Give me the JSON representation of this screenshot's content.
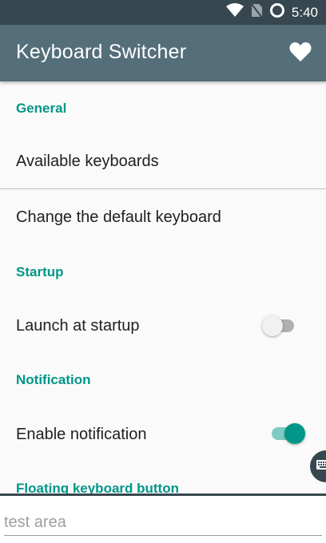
{
  "status_bar": {
    "time": "5:40"
  },
  "app_bar": {
    "title": "Keyboard Switcher"
  },
  "sections": {
    "general": {
      "header": "General",
      "available_keyboards": "Available keyboards",
      "change_default": "Change the default keyboard"
    },
    "startup": {
      "header": "Startup",
      "launch_at_startup": "Launch at startup",
      "launch_at_startup_on": false
    },
    "notification": {
      "header": "Notification",
      "enable_notification": "Enable notification",
      "enable_notification_on": true
    },
    "floating": {
      "header": "Floating keyboard button"
    }
  },
  "test_area": {
    "placeholder": "test area",
    "value": ""
  },
  "colors": {
    "status_bar": "#37474f",
    "app_bar": "#546e7a",
    "accent": "#009688",
    "switch_on_thumb": "#009688",
    "switch_on_track": "#80cbc4",
    "switch_off_thumb": "#f1f1f1",
    "switch_off_track": "#b0b0b0"
  },
  "icons": {
    "favorite": "heart-icon",
    "wifi": "wifi-icon",
    "no_sim": "no-sim-icon",
    "sync": "circle-status-icon",
    "keyboard": "keyboard-icon"
  }
}
